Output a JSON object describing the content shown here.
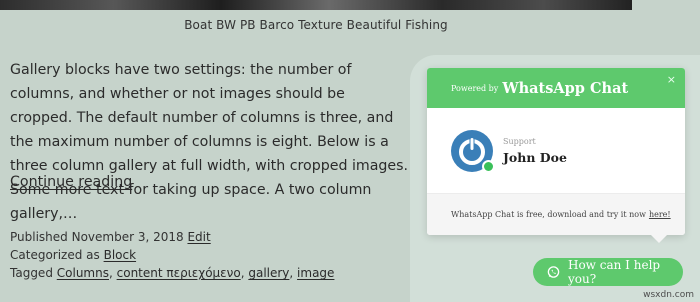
{
  "caption": "Boat BW PB Barco Texture Beautiful Fishing",
  "body_text": "Gallery blocks have two settings: the number of columns, and whether or not images should be cropped. The default number of columns is three, and the maximum number of columns is eight. Below is a three column gallery at full width, with cropped images. Some more text for taking up space. A two column gallery,…",
  "continue_link": "Continue reading",
  "meta": {
    "published_prefix": "Published November 3, 2018",
    "edit": "Edit",
    "category_prefix": "Categorized as",
    "category": "Block",
    "tags_prefix": "Tagged",
    "tags": [
      "Columns",
      "content περιεχόμενο",
      "gallery",
      "image"
    ]
  },
  "whatsapp": {
    "powered_by": "Powered by",
    "title": "WhatsApp Chat",
    "close": "×",
    "agent_role": "Support",
    "agent_name": "John Doe",
    "footer_text": "WhatsApp Chat is free, download and try it now",
    "footer_link": "here!",
    "button_label": "How can I help you?",
    "accent_color": "#5ec96d"
  },
  "watermark": "wsxdn.com"
}
